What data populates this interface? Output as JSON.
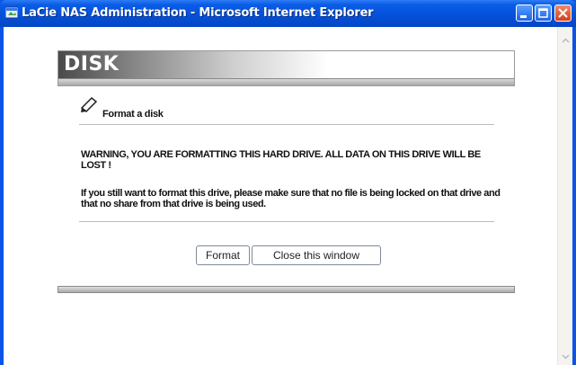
{
  "window": {
    "title": "LaCie NAS Administration - Microsoft Internet Explorer",
    "controls": {
      "minimize": "minimize",
      "maximize": "maximize",
      "close": "close"
    }
  },
  "page": {
    "header_title": "DISK",
    "section_title": "Format a disk",
    "warning": "WARNING, YOU ARE FORMATTING THIS HARD DRIVE. ALL DATA ON THIS DRIVE WILL BE LOST !",
    "info": "If you still want to format this drive, please make sure that no file is being locked on that drive and that no share from that drive is being used.",
    "buttons": {
      "format": "Format",
      "close_window": "Close this window"
    }
  },
  "colors": {
    "titlebar": "#0a54e8",
    "close_button": "#d0401c"
  }
}
